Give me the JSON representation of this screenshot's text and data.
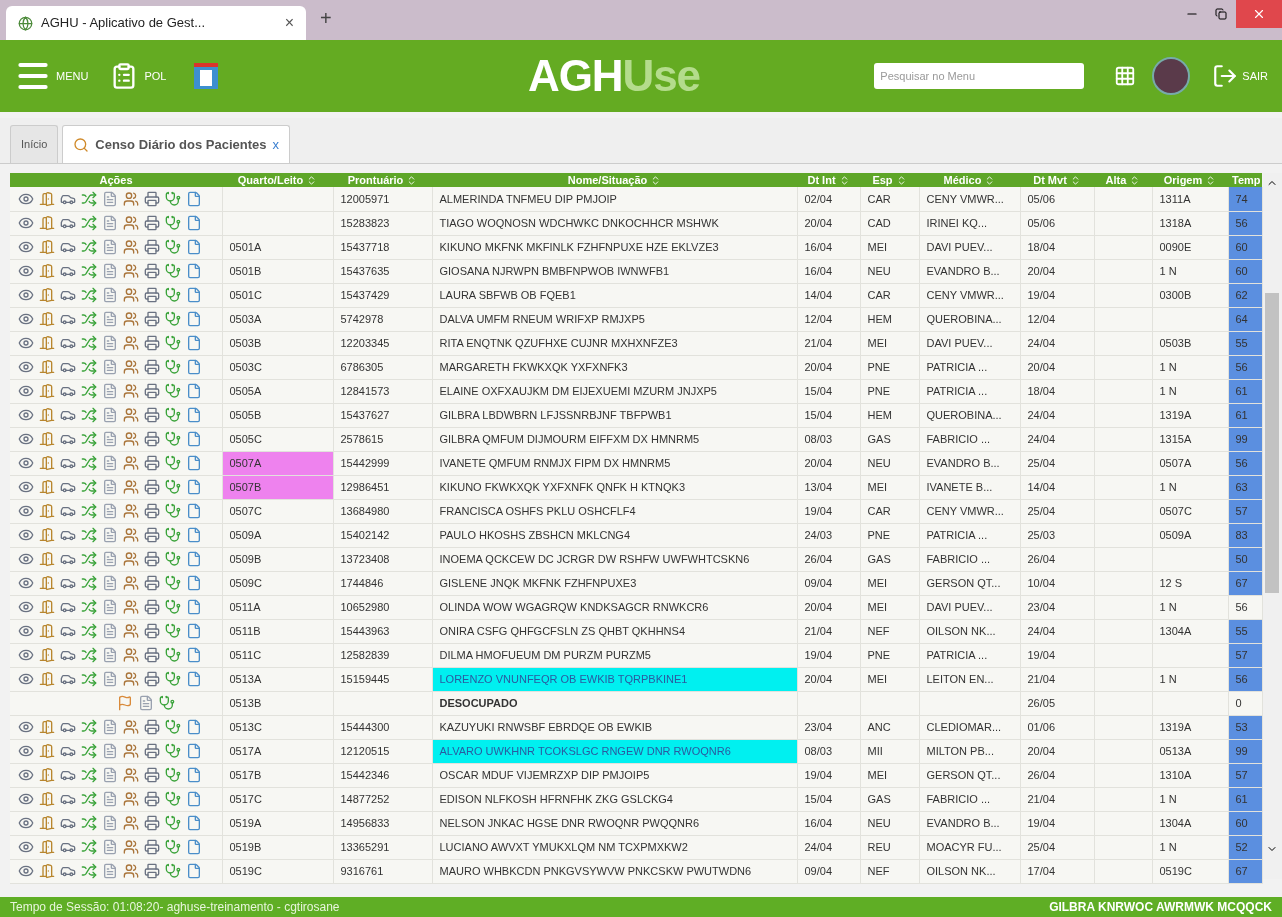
{
  "browser": {
    "tab_title": "AGHU - Aplicativo de Gest...",
    "close": "×",
    "new_tab": "+"
  },
  "header": {
    "menu_label": "MENU",
    "pol_label": "POL",
    "logo": [
      "AGH",
      "Use"
    ],
    "search": {
      "placeholder": "Pesquisar no Menu"
    },
    "exit_label": "SAIR"
  },
  "tabs": [
    {
      "label": "Início",
      "selected": false,
      "closable": false
    },
    {
      "label": "Censo Diário dos Pacientes",
      "selected": true,
      "closable": true,
      "close": "x"
    }
  ],
  "table": {
    "columns": [
      {
        "label": "Ações",
        "sortable": false
      },
      {
        "label": "Quarto/Leito",
        "sortable": true
      },
      {
        "label": "Prontuário",
        "sortable": true
      },
      {
        "label": "Nome/Situação",
        "sortable": true
      },
      {
        "label": "Dt Int",
        "sortable": true
      },
      {
        "label": "Esp",
        "sortable": true
      },
      {
        "label": "Médico",
        "sortable": true
      },
      {
        "label": "Dt Mvt",
        "sortable": true
      },
      {
        "label": "Alta",
        "sortable": true
      },
      {
        "label": "Origem",
        "sortable": true
      },
      {
        "label": "Temp"
      }
    ],
    "rows": [
      {
        "kind": "occupied",
        "bed": "",
        "bed_highlighted": false,
        "record": "12005971",
        "name": "ALMERINDA TNFMEU DIP PMJOIP",
        "name_highlighted": false,
        "dt_int": "02/04",
        "esp": "CAR",
        "doctor": "CENY VMWR...",
        "dt_mvt": "05/06",
        "origin": "1311A",
        "temp": "74",
        "temp_highlighted": true
      },
      {
        "kind": "occupied",
        "bed": "",
        "bed_highlighted": false,
        "record": "15283823",
        "name": "TIAGO WOQNOSN WDCHWKC DNKOCHHCR MSHWK",
        "name_highlighted": false,
        "dt_int": "20/04",
        "esp": "CAD",
        "doctor": "IRINEI KQ...",
        "dt_mvt": "05/06",
        "origin": "1318A",
        "temp": "56",
        "temp_highlighted": true
      },
      {
        "kind": "occupied",
        "bed": "0501A",
        "bed_highlighted": false,
        "record": "15437718",
        "name": "KIKUNO MKFNK MKFINLK FZHFNPUXE HZE EKLVZE3",
        "name_highlighted": false,
        "dt_int": "16/04",
        "esp": "MEI",
        "doctor": "DAVI PUEV...",
        "dt_mvt": "18/04",
        "origin": "0090E",
        "temp": "60",
        "temp_highlighted": true
      },
      {
        "kind": "occupied",
        "bed": "0501B",
        "bed_highlighted": false,
        "record": "15437635",
        "name": "GIOSANA NJRWPN BMBFNPWOB IWNWFB1",
        "name_highlighted": false,
        "dt_int": "16/04",
        "esp": "NEU",
        "doctor": "EVANDRO B...",
        "dt_mvt": "20/04",
        "origin": "1 N",
        "temp": "60",
        "temp_highlighted": true
      },
      {
        "kind": "occupied",
        "bed": "0501C",
        "bed_highlighted": false,
        "record": "15437429",
        "name": "LAURA SBFWB OB FQEB1",
        "name_highlighted": false,
        "dt_int": "14/04",
        "esp": "CAR",
        "doctor": "CENY VMWR...",
        "dt_mvt": "19/04",
        "origin": "0300B",
        "temp": "62",
        "temp_highlighted": true
      },
      {
        "kind": "occupied",
        "bed": "0503A",
        "bed_highlighted": false,
        "record": "5742978",
        "name": "DALVA UMFM RNEUM WRIFXP RMJXP5",
        "name_highlighted": false,
        "dt_int": "12/04",
        "esp": "HEM",
        "doctor": "QUEROBINA...",
        "dt_mvt": "12/04",
        "origin": "",
        "temp": "64",
        "temp_highlighted": true
      },
      {
        "kind": "occupied",
        "bed": "0503B",
        "bed_highlighted": false,
        "record": "12203345",
        "name": "RITA ENQTNK QZUFHXE CUJNR MXHXNFZE3",
        "name_highlighted": false,
        "dt_int": "21/04",
        "esp": "MEI",
        "doctor": "DAVI PUEV...",
        "dt_mvt": "24/04",
        "origin": "0503B",
        "temp": "55",
        "temp_highlighted": true
      },
      {
        "kind": "occupied",
        "bed": "0503C",
        "bed_highlighted": false,
        "record": "6786305",
        "name": "MARGARETH FKWKXQK YXFXNFK3",
        "name_highlighted": false,
        "dt_int": "20/04",
        "esp": "PNE",
        "doctor": "PATRICIA ...",
        "dt_mvt": "20/04",
        "origin": "1 N",
        "temp": "56",
        "temp_highlighted": true
      },
      {
        "kind": "occupied",
        "bed": "0505A",
        "bed_highlighted": false,
        "record": "12841573",
        "name": "ELAINE OXFXAUJKM DM EIJEXUEMI MZURM JNJXP5",
        "name_highlighted": false,
        "dt_int": "15/04",
        "esp": "PNE",
        "doctor": "PATRICIA ...",
        "dt_mvt": "18/04",
        "origin": "1 N",
        "temp": "61",
        "temp_highlighted": true
      },
      {
        "kind": "occupied",
        "bed": "0505B",
        "bed_highlighted": false,
        "record": "15437627",
        "name": "GILBRA LBDWBRN LFJSSNRBJNF TBFPWB1",
        "name_highlighted": false,
        "dt_int": "15/04",
        "esp": "HEM",
        "doctor": "QUEROBINA...",
        "dt_mvt": "24/04",
        "origin": "1319A",
        "temp": "61",
        "temp_highlighted": true
      },
      {
        "kind": "occupied",
        "bed": "0505C",
        "bed_highlighted": false,
        "record": "2578615",
        "name": "GILBRA QMFUM DIJMOURM EIFFXM DX HMNRM5",
        "name_highlighted": false,
        "dt_int": "08/03",
        "esp": "GAS",
        "doctor": "FABRICIO ...",
        "dt_mvt": "24/04",
        "origin": "1315A",
        "temp": "99",
        "temp_highlighted": true
      },
      {
        "kind": "occupied",
        "bed": "0507A",
        "bed_highlighted": true,
        "record": "15442999",
        "name": "IVANETE QMFUM RNMJX FIPM DX HMNRM5",
        "name_highlighted": false,
        "dt_int": "20/04",
        "esp": "NEU",
        "doctor": "EVANDRO B...",
        "dt_mvt": "25/04",
        "origin": "0507A",
        "temp": "56",
        "temp_highlighted": true
      },
      {
        "kind": "occupied",
        "bed": "0507B",
        "bed_highlighted": true,
        "record": "12986451",
        "name": "KIKUNO FKWKXQK YXFXNFK QNFK H KTNQK3",
        "name_highlighted": false,
        "dt_int": "13/04",
        "esp": "MEI",
        "doctor": "IVANETE B...",
        "dt_mvt": "14/04",
        "origin": "1 N",
        "temp": "63",
        "temp_highlighted": true
      },
      {
        "kind": "occupied",
        "bed": "0507C",
        "bed_highlighted": false,
        "record": "13684980",
        "name": "FRANCISCA OSHFS PKLU OSHCFLF4",
        "name_highlighted": false,
        "dt_int": "19/04",
        "esp": "CAR",
        "doctor": "CENY VMWR...",
        "dt_mvt": "25/04",
        "origin": "0507C",
        "temp": "57",
        "temp_highlighted": true
      },
      {
        "kind": "occupied",
        "bed": "0509A",
        "bed_highlighted": false,
        "record": "15402142",
        "name": "PAULO HKOSHS ZBSHCN MKLCNG4",
        "name_highlighted": false,
        "dt_int": "24/03",
        "esp": "PNE",
        "doctor": "PATRICIA ...",
        "dt_mvt": "25/03",
        "origin": "0509A",
        "temp": "83",
        "temp_highlighted": true
      },
      {
        "kind": "occupied",
        "bed": "0509B",
        "bed_highlighted": false,
        "record": "13723408",
        "name": "INOEMA QCKCEW DC JCRGR DW RSHFW UWFWHTCSKN6",
        "name_highlighted": false,
        "dt_int": "26/04",
        "esp": "GAS",
        "doctor": "FABRICIO ...",
        "dt_mvt": "26/04",
        "origin": "",
        "temp": "50",
        "temp_highlighted": true
      },
      {
        "kind": "occupied",
        "bed": "0509C",
        "bed_highlighted": false,
        "record": "1744846",
        "name": "GISLENE JNQK MKFNK FZHFNPUXE3",
        "name_highlighted": false,
        "dt_int": "09/04",
        "esp": "MEI",
        "doctor": "GERSON QT...",
        "dt_mvt": "10/04",
        "origin": "12 S",
        "temp": "67",
        "temp_highlighted": true
      },
      {
        "kind": "occupied",
        "bed": "0511A",
        "bed_highlighted": false,
        "record": "10652980",
        "name": "OLINDA WOW WGAGRQW KNDKSAGCR RNWKCR6",
        "name_highlighted": false,
        "dt_int": "20/04",
        "esp": "MEI",
        "doctor": "DAVI PUEV...",
        "dt_mvt": "23/04",
        "origin": "1 N",
        "temp": "56",
        "temp_highlighted": false
      },
      {
        "kind": "occupied",
        "bed": "0511B",
        "bed_highlighted": false,
        "record": "15443963",
        "name": "ONIRA CSFG QHFGCFSLN ZS QHBT QKHHNS4",
        "name_highlighted": false,
        "dt_int": "21/04",
        "esp": "NEF",
        "doctor": "OILSON NK...",
        "dt_mvt": "24/04",
        "origin": "1304A",
        "temp": "55",
        "temp_highlighted": true
      },
      {
        "kind": "occupied",
        "bed": "0511C",
        "bed_highlighted": false,
        "record": "12582839",
        "name": "DILMA HMOFUEUM DM PURZM PURZM5",
        "name_highlighted": false,
        "dt_int": "19/04",
        "esp": "PNE",
        "doctor": "PATRICIA ...",
        "dt_mvt": "19/04",
        "origin": "",
        "temp": "57",
        "temp_highlighted": true
      },
      {
        "kind": "occupied",
        "bed": "0513A",
        "bed_highlighted": false,
        "record": "15159445",
        "name": "LORENZO VNUNFEQR OB EWKIB TQRPBKINE1",
        "name_highlighted": true,
        "dt_int": "20/04",
        "esp": "MEI",
        "doctor": "LEITON EN...",
        "dt_mvt": "21/04",
        "origin": "1 N",
        "temp": "56",
        "temp_highlighted": true
      },
      {
        "kind": "vacant",
        "bed": "0513B",
        "bed_highlighted": false,
        "record": "",
        "name": "DESOCUPADO",
        "name_highlighted": false,
        "dt_int": "",
        "esp": "",
        "doctor": "",
        "dt_mvt": "26/05",
        "origin": "",
        "temp": "0",
        "temp_highlighted": false
      },
      {
        "kind": "occupied",
        "bed": "0513C",
        "bed_highlighted": false,
        "record": "15444300",
        "name": "KAZUYUKI RNWSBF EBRDQE OB EWKIB",
        "name_highlighted": false,
        "dt_int": "23/04",
        "esp": "ANC",
        "doctor": "CLEDIOMAR...",
        "dt_mvt": "01/06",
        "origin": "1319A",
        "temp": "53",
        "temp_highlighted": true
      },
      {
        "kind": "occupied",
        "bed": "0517A",
        "bed_highlighted": false,
        "record": "12120515",
        "name": "ALVARO UWKHNR TCOKSLGC RNGEW DNR RWOQNR6",
        "name_highlighted": true,
        "dt_int": "08/03",
        "esp": "MII",
        "doctor": "MILTON PB...",
        "dt_mvt": "20/04",
        "origin": "0513A",
        "temp": "99",
        "temp_highlighted": true
      },
      {
        "kind": "occupied",
        "bed": "0517B",
        "bed_highlighted": false,
        "record": "15442346",
        "name": "OSCAR MDUF VIJEMRZXP DIP PMJOIP5",
        "name_highlighted": false,
        "dt_int": "19/04",
        "esp": "MEI",
        "doctor": "GERSON QT...",
        "dt_mvt": "26/04",
        "origin": "1310A",
        "temp": "57",
        "temp_highlighted": true
      },
      {
        "kind": "occupied",
        "bed": "0517C",
        "bed_highlighted": false,
        "record": "14877252",
        "name": "EDISON NLFKOSH HFRNFHK ZKG GSLCKG4",
        "name_highlighted": false,
        "dt_int": "15/04",
        "esp": "GAS",
        "doctor": "FABRICIO ...",
        "dt_mvt": "21/04",
        "origin": "1 N",
        "temp": "61",
        "temp_highlighted": true
      },
      {
        "kind": "occupied",
        "bed": "0519A",
        "bed_highlighted": false,
        "record": "14956833",
        "name": "NELSON JNKAC HGSE DNR RWOQNR PWQQNR6",
        "name_highlighted": false,
        "dt_int": "16/04",
        "esp": "NEU",
        "doctor": "EVANDRO B...",
        "dt_mvt": "19/04",
        "origin": "1304A",
        "temp": "60",
        "temp_highlighted": true
      },
      {
        "kind": "occupied",
        "bed": "0519B",
        "bed_highlighted": false,
        "record": "13365291",
        "name": "LUCIANO AWVXT YMUKXLQM NM TCXPMXKW2",
        "name_highlighted": false,
        "dt_int": "24/04",
        "esp": "REU",
        "doctor": "MOACYR FU...",
        "dt_mvt": "25/04",
        "origin": "1 N",
        "temp": "52",
        "temp_highlighted": true
      },
      {
        "kind": "occupied",
        "bed": "0519C",
        "bed_highlighted": false,
        "record": "9316761",
        "name": "MAURO WHBKCDN PNKGVSYWVW PNKCSKW PWUTWDN6",
        "name_highlighted": false,
        "dt_int": "09/04",
        "esp": "NEF",
        "doctor": "OILSON NK...",
        "dt_mvt": "17/04",
        "origin": "0519C",
        "temp": "67",
        "temp_highlighted": true
      }
    ]
  },
  "status_bar": {
    "session": "Tempo de Sessão: 01:08:20- aghuse-treinamento - cgtirosane",
    "user": "GILBRA KNRWOC AWRMWK MCQQCK"
  }
}
